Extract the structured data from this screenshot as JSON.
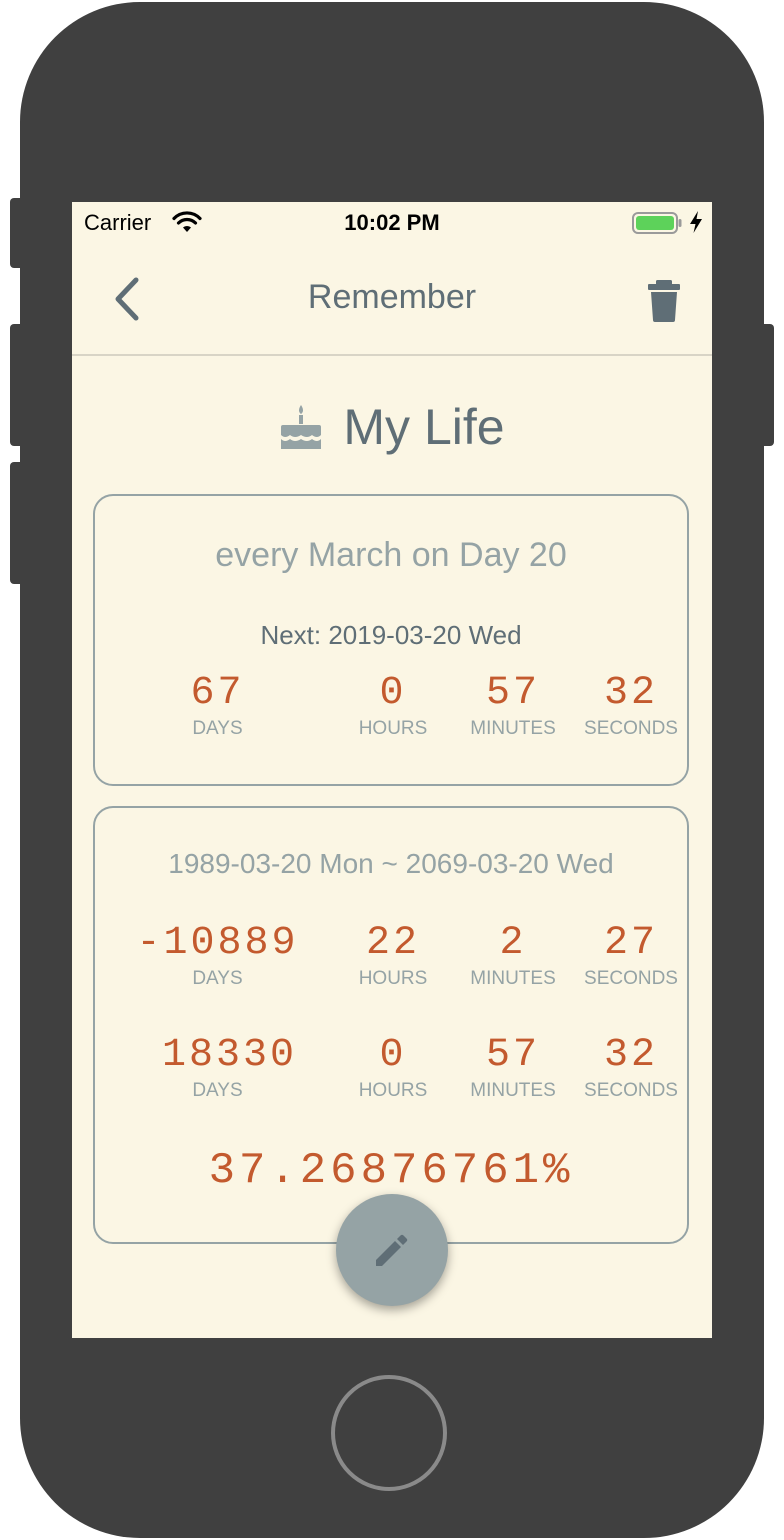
{
  "status_bar": {
    "carrier": "Carrier",
    "time": "10:02 PM",
    "wifi_icon": "wifi-icon",
    "battery_icon": "battery-icon",
    "charging_icon": "bolt-icon"
  },
  "nav": {
    "title": "Remember",
    "back_icon": "chevron-left-icon",
    "delete_icon": "trash-icon"
  },
  "event": {
    "icon": "cake-icon",
    "title": "My Life"
  },
  "recurring_card": {
    "rule": "every March on Day 20",
    "next": "Next: 2019-03-20 Wed",
    "countdown": {
      "days": "67",
      "days_label": "DAYS",
      "hours": "0",
      "hours_label": "HOURS",
      "minutes": "57",
      "minutes_label": "MINUTES",
      "seconds": "32",
      "seconds_label": "SECONDS"
    }
  },
  "range_card": {
    "range": "1989-03-20 Mon ~ 2069-03-20 Wed",
    "elapsed": {
      "days": "-10889",
      "days_label": "DAYS",
      "hours": "22",
      "hours_label": "HOURS",
      "minutes": "2",
      "minutes_label": "MINUTES",
      "seconds": "27",
      "seconds_label": "SECONDS"
    },
    "remaining": {
      "days": "18330",
      "days_label": "DAYS",
      "hours": "0",
      "hours_label": "HOURS",
      "minutes": "57",
      "minutes_label": "MINUTES",
      "seconds": "32",
      "seconds_label": "SECONDS"
    },
    "percent": "37.26876761%"
  },
  "fab": {
    "icon": "pencil-icon"
  },
  "colors": {
    "screen_bg": "#fbf6e4",
    "accent": "#c35a2e",
    "muted": "#95a3a5",
    "title": "#5f6e76",
    "frame": "#404040"
  }
}
